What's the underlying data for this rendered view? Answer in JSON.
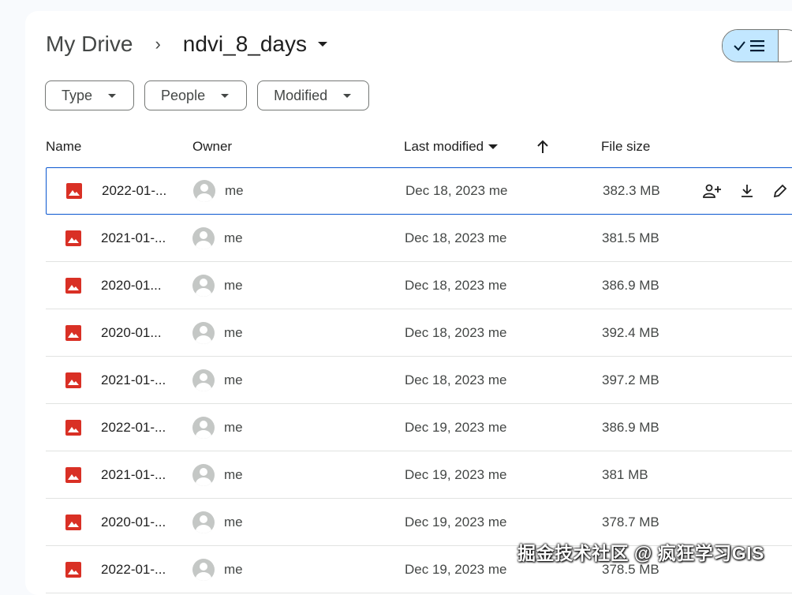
{
  "breadcrumb": {
    "root": "My Drive",
    "separator": "›",
    "current": "ndvi_8_days"
  },
  "filters": [
    {
      "label": "Type"
    },
    {
      "label": "People"
    },
    {
      "label": "Modified"
    }
  ],
  "columns": {
    "name": "Name",
    "owner": "Owner",
    "last_modified": "Last modified",
    "file_size": "File size"
  },
  "files": [
    {
      "name": "2022-01-...",
      "owner": "me",
      "modified": "Dec 18, 2023 me",
      "size": "382.3 MB"
    },
    {
      "name": "2021-01-...",
      "owner": "me",
      "modified": "Dec 18, 2023 me",
      "size": "381.5 MB"
    },
    {
      "name": "2020-01...",
      "owner": "me",
      "modified": "Dec 18, 2023 me",
      "size": "386.9 MB"
    },
    {
      "name": "2020-01...",
      "owner": "me",
      "modified": "Dec 18, 2023 me",
      "size": "392.4 MB"
    },
    {
      "name": "2021-01-...",
      "owner": "me",
      "modified": "Dec 18, 2023 me",
      "size": "397.2 MB"
    },
    {
      "name": "2022-01-...",
      "owner": "me",
      "modified": "Dec 19, 2023 me",
      "size": "386.9 MB"
    },
    {
      "name": "2021-01-...",
      "owner": "me",
      "modified": "Dec 19, 2023 me",
      "size": "381 MB"
    },
    {
      "name": "2020-01-...",
      "owner": "me",
      "modified": "Dec 19, 2023 me",
      "size": "378.7 MB"
    },
    {
      "name": "2022-01-...",
      "owner": "me",
      "modified": "Dec 19, 2023 me",
      "size": "378.5 MB"
    }
  ],
  "watermark": "掘金技术社区 @ 疯狂学习GIS",
  "colors": {
    "file_icon": "#d93025",
    "selected_border": "#0b57d0",
    "toggle_active": "#c2e7ff"
  }
}
